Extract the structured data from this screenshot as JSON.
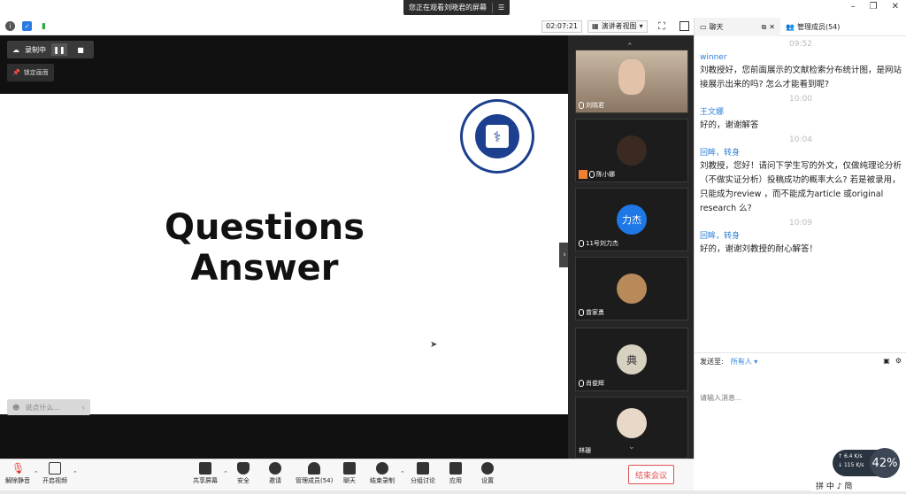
{
  "banner": {
    "text": "您正在观看刘晓君的屏幕"
  },
  "status": {
    "timer": "02:07:21",
    "view_label": "演讲者视图"
  },
  "recording": {
    "label": "录制中",
    "pin_label": "锁定画面"
  },
  "slide": {
    "line1": "Questions",
    "line2": "Answer",
    "chat_hint": "说点什么..."
  },
  "participants": [
    {
      "name": "刘晓君",
      "avatar_color": "#c8a58a"
    },
    {
      "name": "陈小娜",
      "avatar_color": "#3a2a22"
    },
    {
      "name": "11号刘力杰",
      "avatar_text": "力杰",
      "avatar_color": "#1e78e6"
    },
    {
      "name": "曾家勇",
      "avatar_color": "#b88a5a"
    },
    {
      "name": "肖俊辉",
      "avatar_text": "典",
      "avatar_color": "#d8d0c0"
    },
    {
      "name": "林珊",
      "avatar_color": "#e8d8c8"
    }
  ],
  "chat": {
    "tab_chat": "聊天",
    "tab_members": "管理成员(54)",
    "messages": [
      {
        "time": "09:52",
        "sender": "winner",
        "text": "刘教授好，您前面展示的文献检索分布统计图，是网站\n接展示出来的吗? 怎么才能看到呢?"
      },
      {
        "time": "10:00",
        "sender": "王文娜",
        "text": "好的，谢谢解答"
      },
      {
        "time": "10:04",
        "sender": "回眸，转身",
        "text": "刘教授，您好！请问下学生写的外文，仅做纯理论分析\n（不做实证分析）投稿成功的概率大么? 若是被录用，\n只能成为review ，而不能成为article 或original\nresearch 么?"
      },
      {
        "time": "10:09",
        "sender": "回眸，转身",
        "text": "好的，谢谢刘教授的耐心解答！"
      }
    ],
    "send_to_label": "发送至:",
    "send_target": "所有人",
    "input_placeholder": "请输入消息..."
  },
  "network": {
    "up": "6.4",
    "down": "115",
    "unit": "K/s",
    "percent": "42"
  },
  "toolbar": {
    "unmute": "解除静音",
    "video": "开启视频",
    "share": "共享屏幕",
    "security": "安全",
    "invite": "邀请",
    "members": "管理成员(54)",
    "chat": "聊天",
    "end_record": "结束录制",
    "breakout": "分组讨论",
    "apps": "应用",
    "settings": "设置",
    "end_meeting": "结束会议"
  },
  "ime": {
    "text": "拼 中 ♪ 简"
  }
}
